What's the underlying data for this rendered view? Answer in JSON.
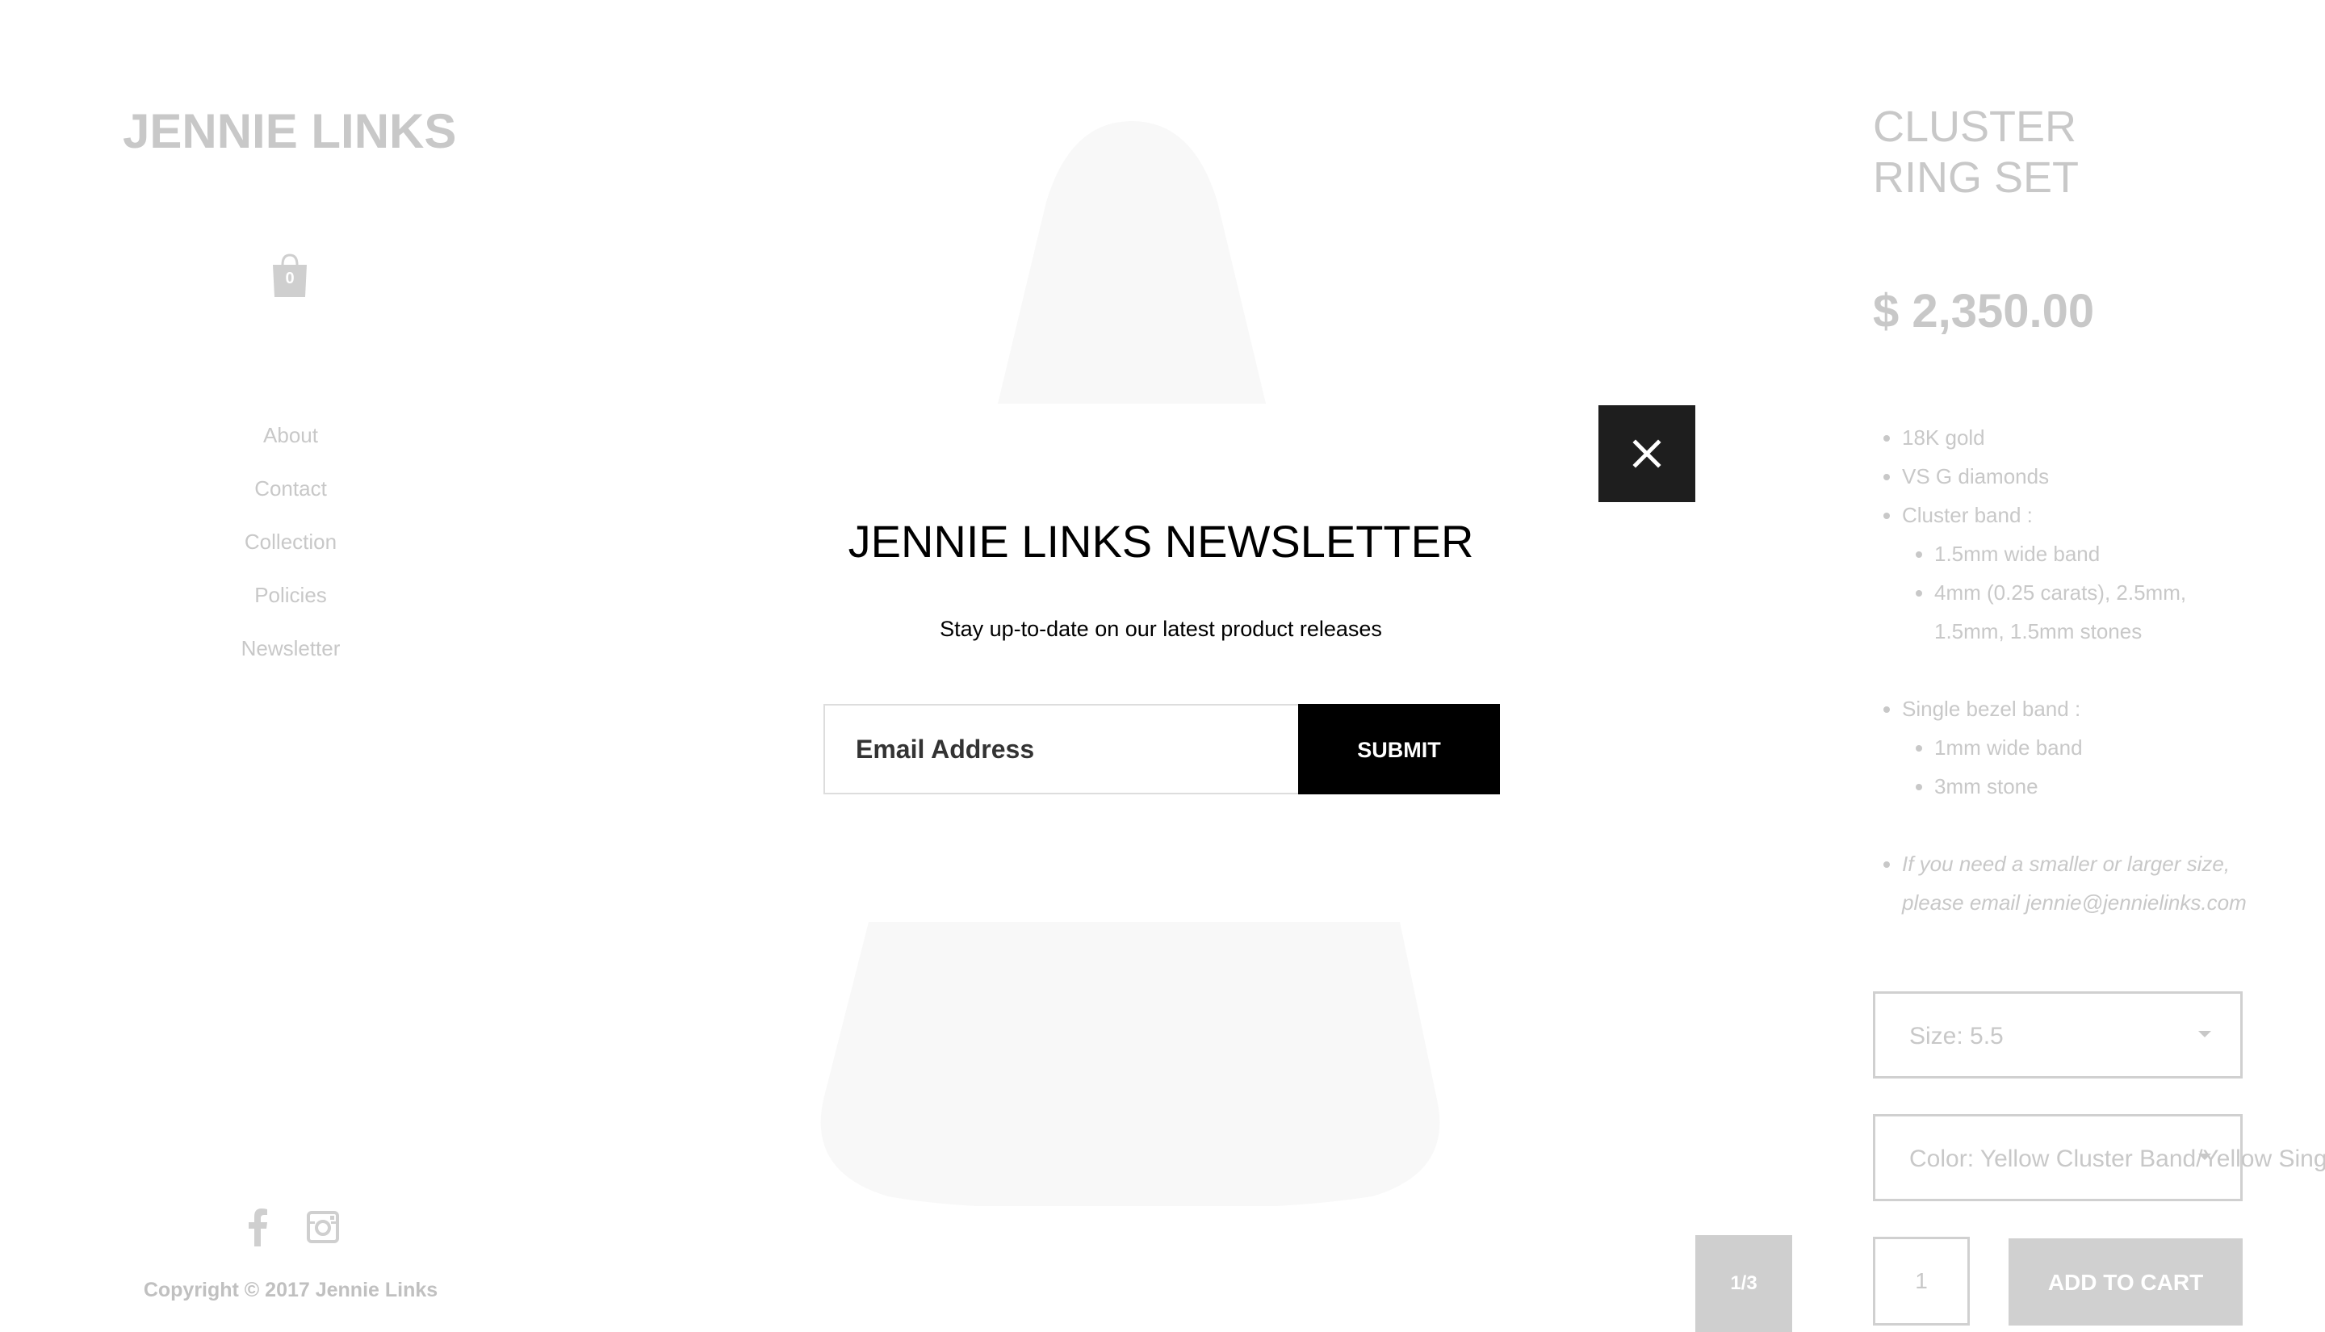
{
  "site": {
    "logo": "JENNIE LINKS",
    "cart_count": "0",
    "nav": [
      "About",
      "Contact",
      "Collection",
      "Policies",
      "Newsletter"
    ],
    "copyright": "Copyright © 2017 Jennie Links"
  },
  "product": {
    "title": "CLUSTER RING SET",
    "price": "$ 2,350.00",
    "details": {
      "gold": "18K gold",
      "diamonds": "VS G diamonds",
      "cluster_band": "Cluster band :",
      "cluster_width": "1.5mm wide band",
      "cluster_stones": "4mm (0.25 carats), 2.5mm, 1.5mm, 1.5mm stones",
      "bezel_band": "Single bezel band :",
      "bezel_width": "1mm wide band",
      "bezel_stone": "3mm stone",
      "size_note": "If you need a smaller or larger size, please email jennie@jennielinks.com"
    },
    "size_select": "Size: 5.5",
    "color_select": "Color: Yellow Cluster Band/Yellow Sing",
    "quantity": "1",
    "add_to_cart": "ADD TO CART",
    "pager": "1/3"
  },
  "modal": {
    "title": "JENNIE LINKS NEWSLETTER",
    "subtitle": "Stay up-to-date on our latest product releases",
    "email_placeholder": "Email Address",
    "submit": "SUBMIT"
  },
  "icons": {
    "cart": "shopping-bag-icon",
    "facebook": "facebook-icon",
    "instagram": "instagram-icon",
    "close": "close-icon"
  },
  "colors": {
    "faded_text": "#c8c8c8",
    "modal_button": "#000000",
    "close_button": "#1e1e1e"
  }
}
